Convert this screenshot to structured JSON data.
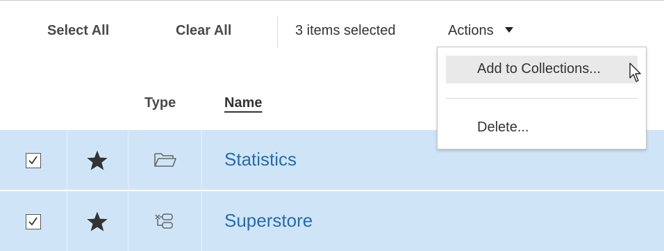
{
  "toolbar": {
    "select_all": "Select All",
    "clear_all": "Clear All",
    "selection_count": "3 items selected",
    "actions_label": "Actions"
  },
  "table": {
    "columns": [
      "Type",
      "Name"
    ],
    "rows": [
      {
        "checked": true,
        "favorite": true,
        "type_icon": "folder-icon",
        "name": "Statistics"
      },
      {
        "checked": true,
        "favorite": true,
        "type_icon": "flow-icon",
        "name": "Superstore"
      }
    ]
  },
  "actions_menu": {
    "items": [
      "Add to Collections...",
      "Delete..."
    ],
    "highlighted_index": 0
  },
  "colors": {
    "row_selected_bg": "#cfe5f7",
    "link": "#2a6ba7",
    "menu_hover": "#e9e9e9"
  }
}
